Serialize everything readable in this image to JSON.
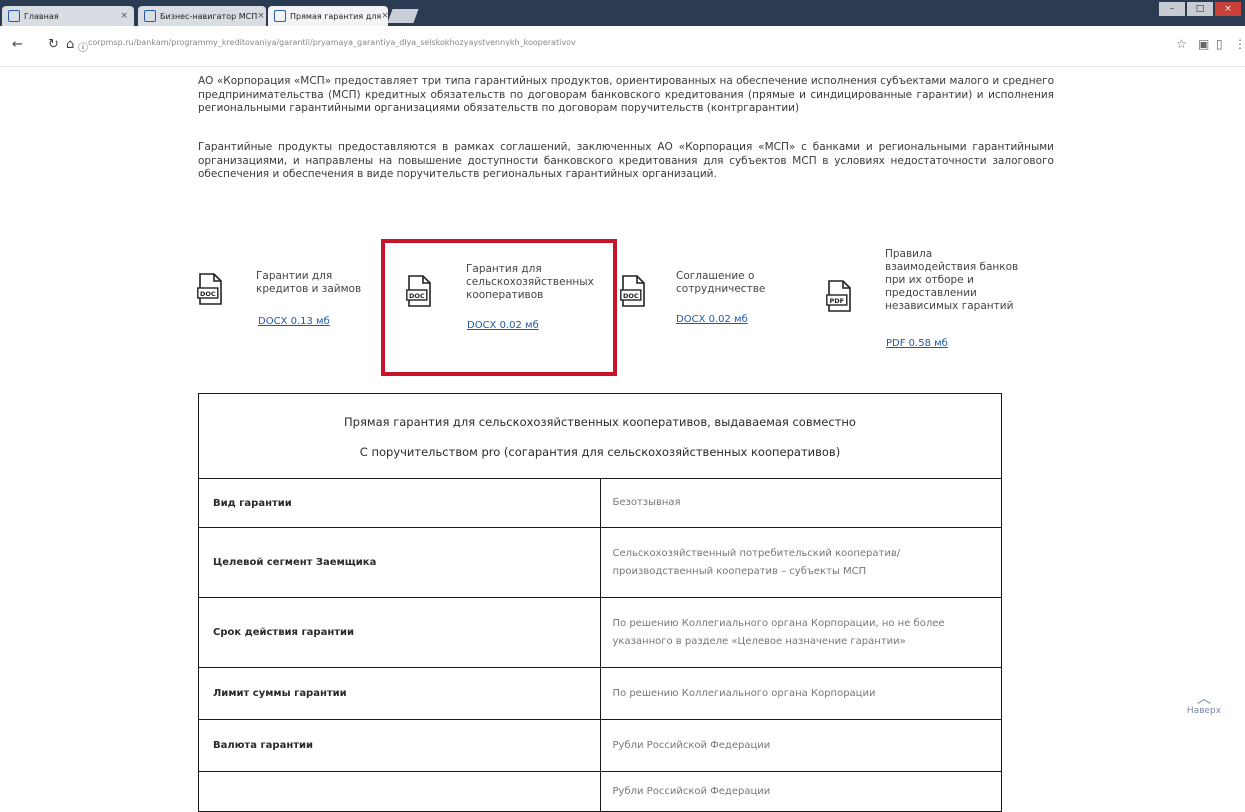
{
  "browser": {
    "tabs": [
      {
        "label": "Главная"
      },
      {
        "label": "Бизнес-навигатор МСП"
      },
      {
        "label": "Прямая гарантия для"
      }
    ],
    "address": "corpmsp.ru/bankam/programmy_kreditovaniya/garantii/pryamaya_garantiya_dlya_selskokhozyaystvennykh_kooperativov"
  },
  "intro": {
    "paragraph1": "АО «Корпорация «МСП» предоставляет три типа гарантийных продуктов, ориентированных на обеспечение исполнения субъектами малого и среднего предпринимательства (МСП) кредитных обязательств по договорам банковского кредитования (прямые и синдицированные гарантии) и исполнения региональными гарантийными организациями обязательств по договорам поручительств (контргарантии)",
    "paragraph2": "Гарантийные продукты предоставляются в рамках соглашений, заключенных АО «Корпорация «МСП» с банками и региональными гарантийными организациями, и направлены на повышение доступности банковского кредитования для субъектов МСП в условиях недостаточности залогового обеспечения и обеспечения в виде поручительств региональных гарантийных организаций."
  },
  "documents": [
    {
      "type": "DOC",
      "title": "Гарантии для кредитов и займов",
      "link": "DOCX 0.13 мб"
    },
    {
      "type": "DOC",
      "title": "Гарантия для сельскохозяйственных кооперативов",
      "link": "DOCX 0.02 мб"
    },
    {
      "type": "DOC",
      "title": "Соглашение о сотрудничестве",
      "link": "DOCX 0.02 мб"
    },
    {
      "type": "PDF",
      "title": "Правила взаимодействия банков при их отборе и предоставлении независимых гарантий",
      "link": "PDF 0.58 мб"
    }
  ],
  "table": {
    "header_line1": "Прямая гарантия для сельскохозяйственных кооперативов, выдаваемая совместно",
    "header_line2": "С поручительством pro (согарантия для сельскохозяйственных кооперативов)",
    "rows": [
      {
        "label": "Вид гарантии",
        "value": "Безотзывная"
      },
      {
        "label": "Целевой сегмент Заемщика",
        "value": "Сельскохозяйственный потребительский кооператив/производственный кооператив – субъекты МСП"
      },
      {
        "label": "Срок действия гарантии",
        "value": "По решению Коллегиального органа Корпорации, но не более указанного в разделе «Целевое назначение гарантии»"
      },
      {
        "label": "Лимит суммы гарантии",
        "value": "По решению Коллегиального органа Корпорации"
      },
      {
        "label": "Валюта гарантии",
        "value": "Рубли Российской Федерации"
      },
      {
        "label": "",
        "value": "Рубли Российской Федерации"
      }
    ]
  },
  "back_to_top": {
    "label": "Наверх"
  }
}
